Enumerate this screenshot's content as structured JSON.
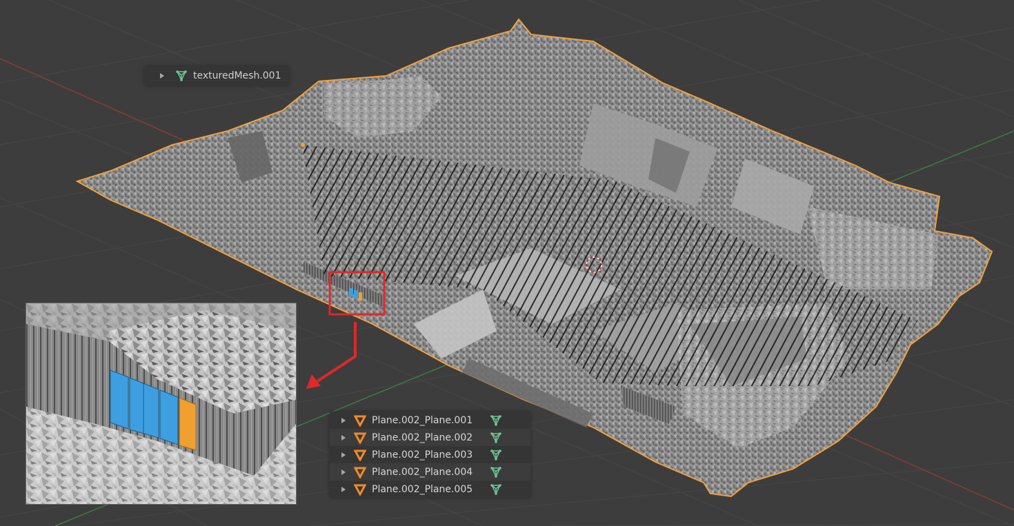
{
  "scene_objects": {
    "top": {
      "name": "textured-mesh-row",
      "label": "texturedMesh.001",
      "icon": "mesh-data-icon"
    },
    "planes": [
      {
        "label": "Plane.002_Plane.001",
        "icon": "mesh-object-icon",
        "data_icon": "mesh-data-icon"
      },
      {
        "label": "Plane.002_Plane.002",
        "icon": "mesh-object-icon",
        "data_icon": "mesh-data-icon"
      },
      {
        "label": "Plane.002_Plane.003",
        "icon": "mesh-object-icon",
        "data_icon": "mesh-data-icon"
      },
      {
        "label": "Plane.002_Plane.004",
        "icon": "mesh-object-icon",
        "data_icon": "mesh-data-icon"
      },
      {
        "label": "Plane.002_Plane.005",
        "icon": "mesh-object-icon",
        "data_icon": "mesh-data-icon"
      }
    ]
  },
  "colors": {
    "background": "#3d3d3d",
    "grid": "#4a4a4a",
    "x_axis": "#8a3b3b",
    "y_axis": "#3f7a4a",
    "selection_outline": "#f3a03a",
    "highlight_box": "#e02828",
    "selected_blue": "#3d9fe0",
    "active_orange": "#f0a030",
    "mesh_icon": "#6fc59a",
    "object_icon": "#f08a2a"
  }
}
